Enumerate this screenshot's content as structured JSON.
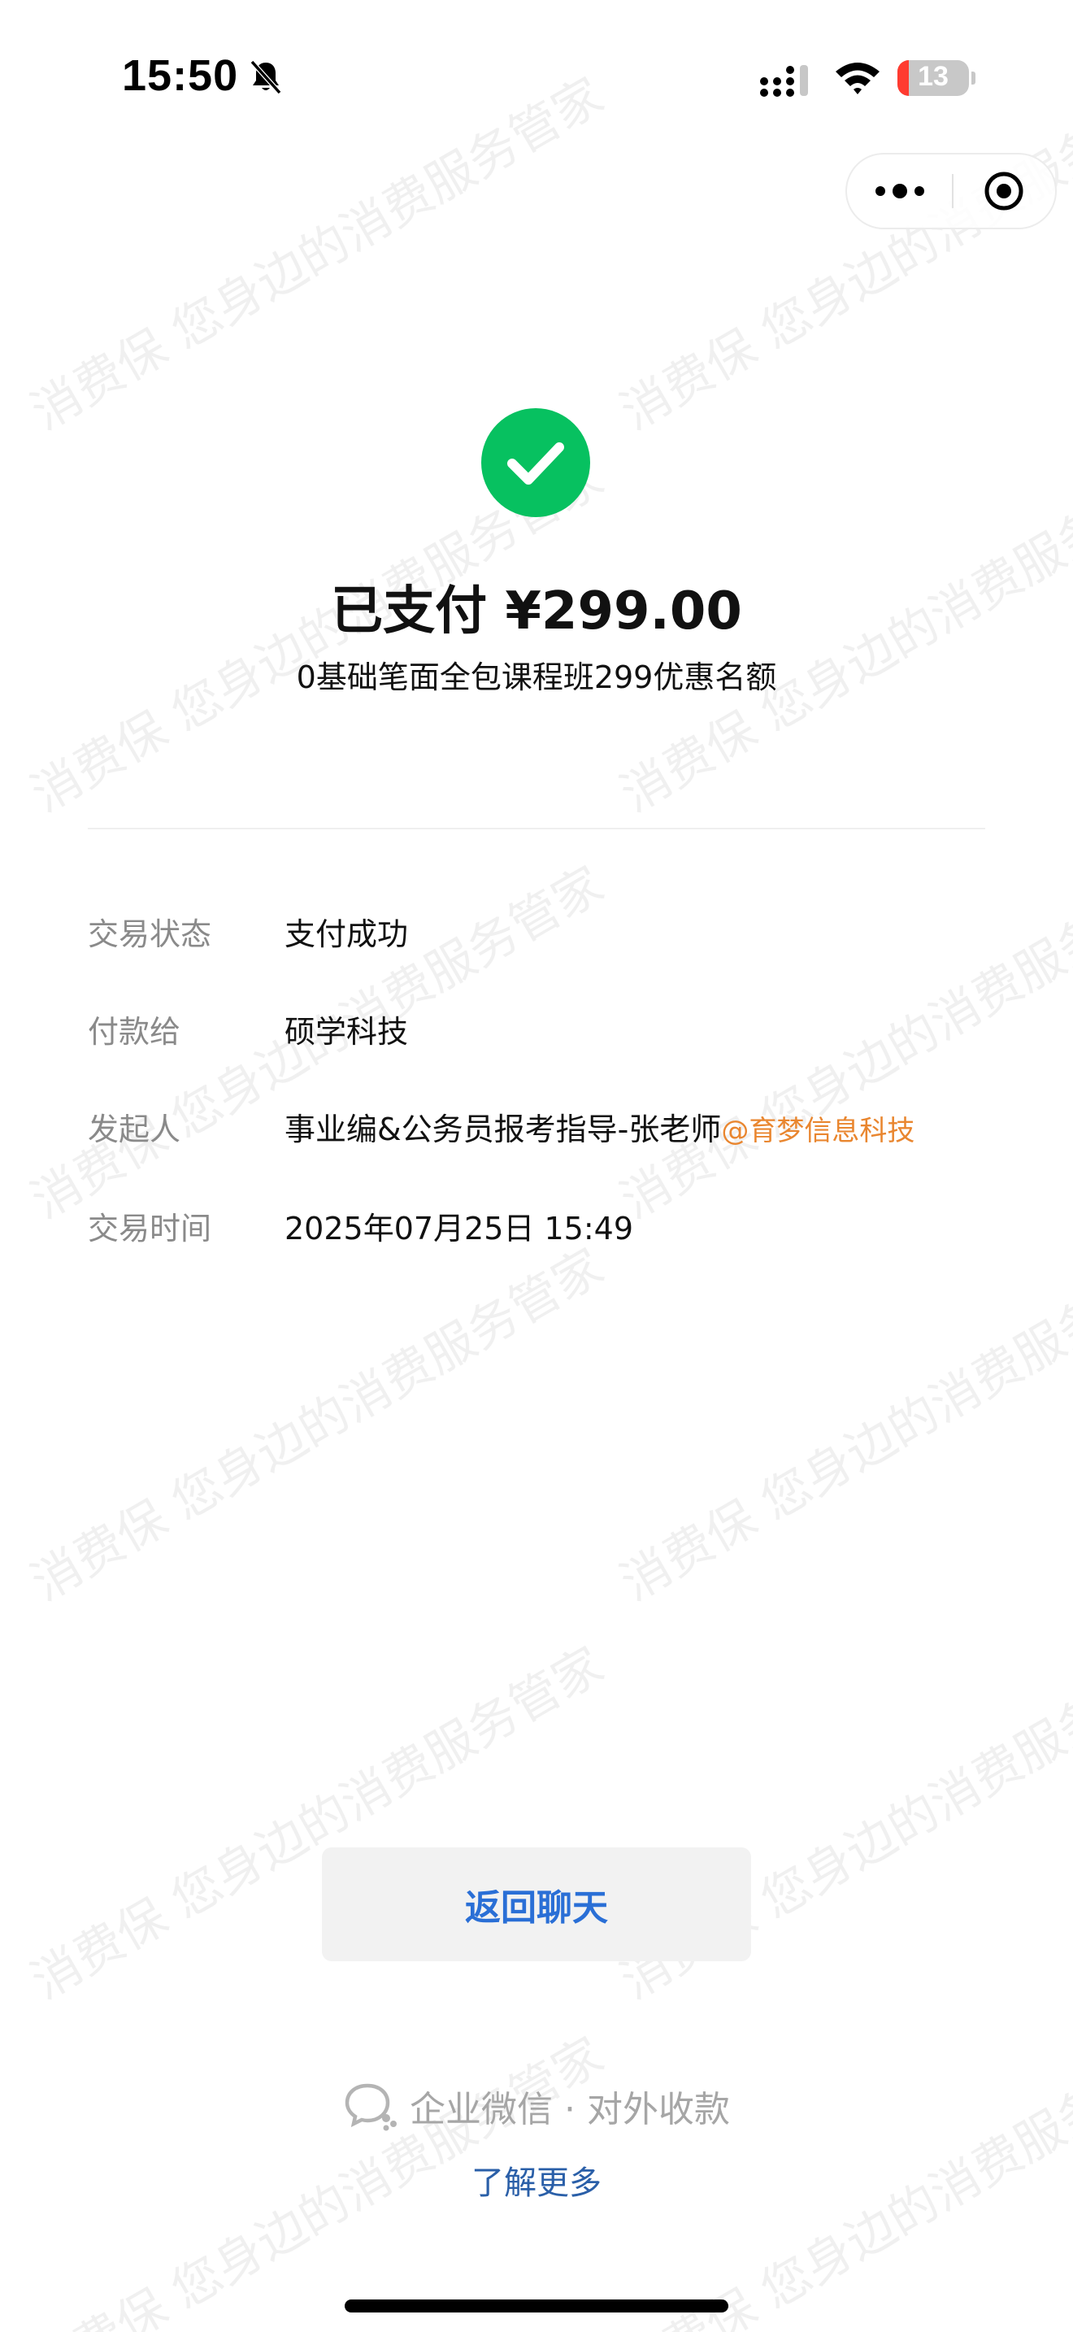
{
  "watermark": {
    "text": "消费保 您身边的消费服务管家"
  },
  "status_bar": {
    "time": "15:50",
    "battery_percent": "13",
    "icons": [
      "mute-bell-icon",
      "cellular-signal-icon",
      "wifi-icon",
      "battery-icon"
    ]
  },
  "capsule": {
    "icons": [
      "more-dots-icon",
      "close-target-icon"
    ]
  },
  "payment": {
    "status_icon": "checkmark-icon",
    "status_color": "#07c160",
    "title": "已支付 ¥299.00",
    "product": "0基础笔面全包课程班299优惠名额"
  },
  "details": [
    {
      "label": "交易状态",
      "value": "支付成功"
    },
    {
      "label": "付款给",
      "value": "硕学科技"
    },
    {
      "label": "发起人",
      "value": "事业编&公务员报考指导-张老师",
      "org": "@育梦信息科技"
    },
    {
      "label": "交易时间",
      "value": "2025年07月25日 15:49"
    }
  ],
  "actions": {
    "back_label": "返回聊天"
  },
  "footer": {
    "brand": "企业微信 · 对外收款",
    "brand_icon": "wecom-chat-icon",
    "learn_more": "了解更多"
  },
  "colors": {
    "accent_green": "#07c160",
    "link_blue": "#2a6fd6",
    "org_orange": "#e9862f",
    "label_gray": "#8a8a8a"
  }
}
